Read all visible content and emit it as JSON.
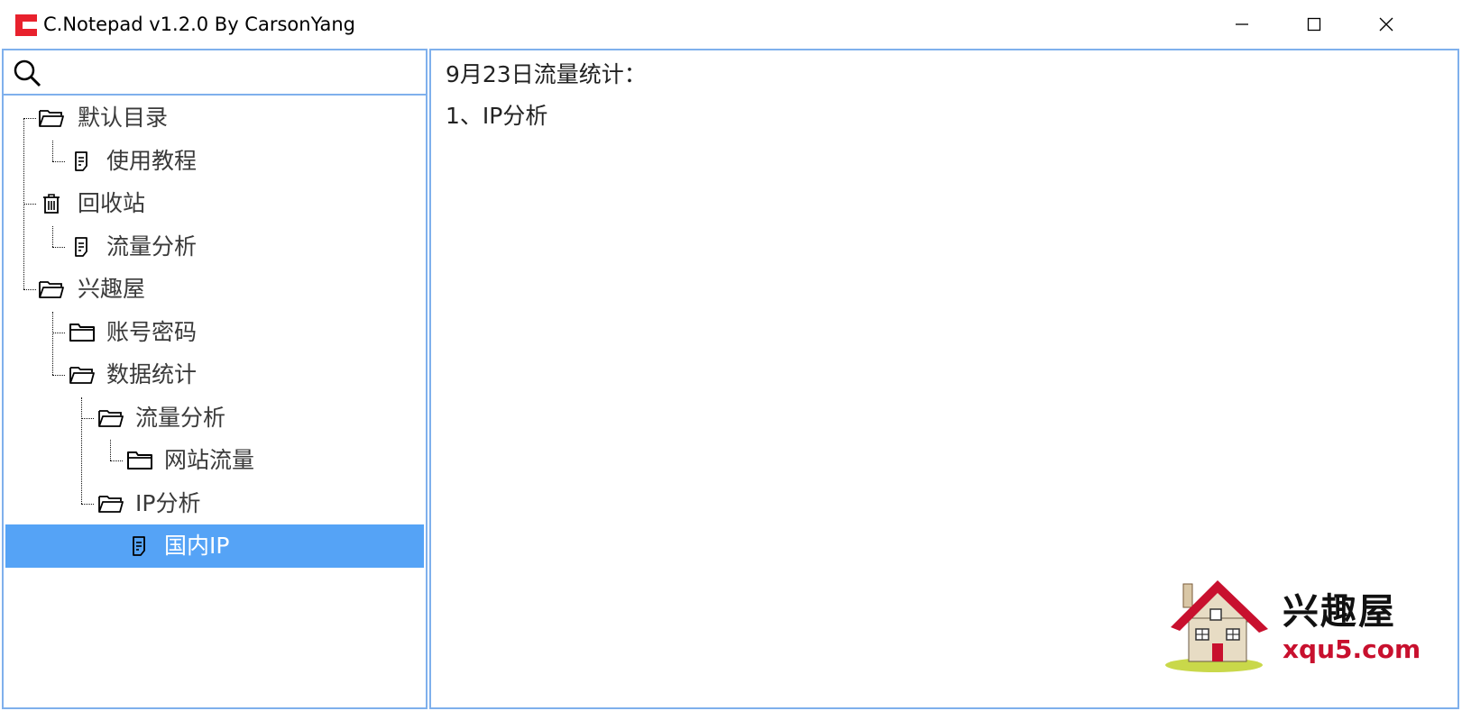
{
  "window": {
    "title": "C.Notepad v1.2.0 By CarsonYang",
    "controls": [
      "minimize",
      "maximize",
      "close"
    ]
  },
  "search": {
    "value": "",
    "placeholder": ""
  },
  "tree": [
    {
      "label": "默认目录",
      "icon": "folder-open-icon",
      "level": 0
    },
    {
      "label": "使用教程",
      "icon": "note-icon",
      "level": 1
    },
    {
      "label": "回收站",
      "icon": "trash-icon",
      "level": 0
    },
    {
      "label": "流量分析",
      "icon": "note-icon",
      "level": 1
    },
    {
      "label": "兴趣屋",
      "icon": "folder-open-icon",
      "level": 0
    },
    {
      "label": "账号密码",
      "icon": "folder-closed-icon",
      "level": 1
    },
    {
      "label": "数据统计",
      "icon": "folder-open-icon",
      "level": 1
    },
    {
      "label": "流量分析",
      "icon": "folder-open-icon",
      "level": 2
    },
    {
      "label": "网站流量",
      "icon": "folder-closed-icon",
      "level": 3
    },
    {
      "label": "IP分析",
      "icon": "folder-open-icon",
      "level": 2
    },
    {
      "label": "国内IP",
      "icon": "note-icon",
      "level": 3,
      "selected": true
    }
  ],
  "editor": {
    "lines": [
      "9月23日流量统计：",
      "1、IP分析"
    ]
  },
  "watermark": {
    "name": "兴趣屋",
    "url": "xqu5.com"
  },
  "colors": {
    "selection": "#55a3f6",
    "border": "#7fb0ec",
    "app_icon": "#e8212d",
    "watermark_url": "#c8102e"
  }
}
